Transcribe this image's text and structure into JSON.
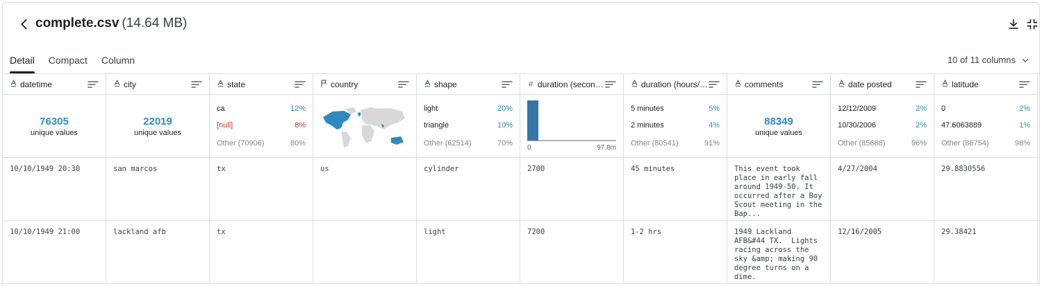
{
  "file": {
    "name": "complete.csv",
    "size": "(14.64 MB)"
  },
  "tabs": [
    "Detail",
    "Compact",
    "Column"
  ],
  "column_selector": "10 of 11 columns",
  "columns": [
    {
      "type_icon": "A",
      "name": "datetime"
    },
    {
      "type_icon": "A",
      "name": "city"
    },
    {
      "type_icon": "A",
      "name": "state"
    },
    {
      "type_icon": "flag",
      "name": "country"
    },
    {
      "type_icon": "A",
      "name": "shape"
    },
    {
      "type_icon": "#",
      "name": "duration (seconds)"
    },
    {
      "type_icon": "A",
      "name": "duration (hours/min)"
    },
    {
      "type_icon": "A",
      "name": "comments"
    },
    {
      "type_icon": "A",
      "name": "date posted"
    },
    {
      "type_icon": "A",
      "name": "latitude"
    }
  ],
  "summary": {
    "datetime": {
      "count": "76305",
      "label": "unique values"
    },
    "city": {
      "count": "22019",
      "label": "unique values"
    },
    "state": {
      "top1": "ca",
      "top1_pct": "12%",
      "null": "[null]",
      "null_pct": "8%",
      "other": "Other (70906)",
      "other_pct": "80%"
    },
    "shape": {
      "top1": "light",
      "top1_pct": "20%",
      "top2": "triangle",
      "top2_pct": "10%",
      "other": "Other (62514)",
      "other_pct": "70%"
    },
    "duration_seconds": {
      "min": "0",
      "max": "97.8m",
      "bar_fraction": 1.0
    },
    "duration_hours": {
      "top1": "5 minutes",
      "top1_pct": "5%",
      "top2": "2 minutes",
      "top2_pct": "4%",
      "other": "Other (80541)",
      "other_pct": "91%"
    },
    "comments": {
      "count": "88349",
      "label": "unique values"
    },
    "date_posted": {
      "top1": "12/12/2009",
      "top1_pct": "2%",
      "top2": "10/30/2006",
      "top2_pct": "2%",
      "other": "Other (85688)",
      "other_pct": "96%"
    },
    "latitude": {
      "top1": "0",
      "top1_pct": "2%",
      "top2": "47.6063889",
      "top2_pct": "1%",
      "other": "Other (86754)",
      "other_pct": "98%"
    }
  },
  "rows": [
    [
      "10/10/1949 20:30",
      "san marcos",
      "tx",
      "us",
      "cylinder",
      "2700",
      "45 minutes",
      "This event took place in early fall around 1949-50. It occurred after a Boy Scout meeting in the Bap...",
      "4/27/2004",
      "29.8830556"
    ],
    [
      "10/10/1949 21:00",
      "lackland afb",
      "tx",
      "",
      "light",
      "7200",
      "1-2 hrs",
      "1949 Lackland AFB&#44 TX.  Lights racing across the sky &amp; making 90 degree turns on a dime.",
      "12/16/2005",
      "29.38421"
    ]
  ],
  "colors": {
    "accent": "#2e8bc0",
    "null": "#d93025",
    "hist_bar": "#3476a8",
    "map_highlight": "#2e8bc0",
    "map_base": "#d8d8d8"
  }
}
